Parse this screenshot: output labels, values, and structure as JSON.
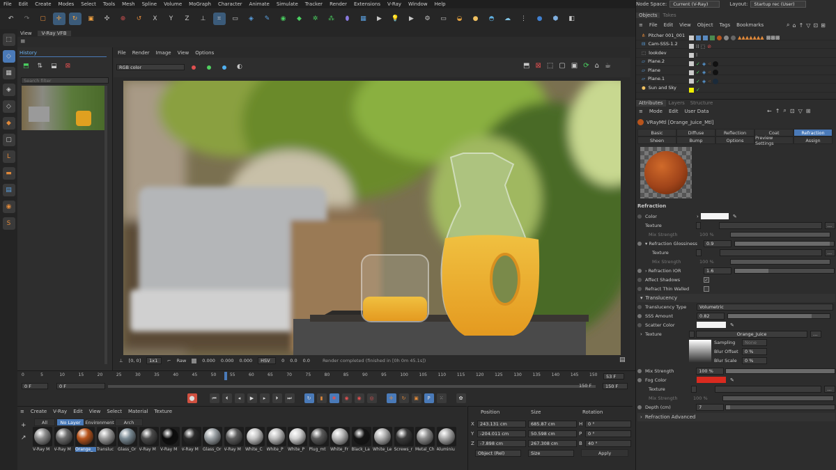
{
  "menubar": {
    "items": [
      "File",
      "Edit",
      "Create",
      "Modes",
      "Select",
      "Tools",
      "Mesh",
      "Spline",
      "Volume",
      "MoGraph",
      "Character",
      "Animate",
      "Simulate",
      "Tracker",
      "Render",
      "Extensions",
      "V-Ray",
      "Window",
      "Help"
    ],
    "node_space_label": "Node Space:",
    "node_space_value": "Current (V-Ray)",
    "layout_label": "Layout:",
    "layout_value": "Startup rec (User)"
  },
  "view_tabs": {
    "view": "View",
    "vfb": "V-Ray VFB"
  },
  "vfb": {
    "history_title": "History",
    "search_placeholder": "Search filter",
    "menu": [
      "File",
      "Render",
      "Image",
      "View",
      "Options"
    ],
    "channel": "RGB color",
    "status": {
      "coords": "[0, 0]",
      "zoom": "1x1",
      "raw_label": "Raw",
      "v1": "0.000",
      "v2": "0.000",
      "v3": "0.000",
      "mode": "HSV",
      "v4": "0",
      "v5": "0.0",
      "v6": "0.0",
      "message": "Render completed (finished in [0h  0m  45.1s])"
    }
  },
  "timeline": {
    "ticks": [
      "0",
      "5",
      "10",
      "15",
      "20",
      "25",
      "30",
      "35",
      "40",
      "45",
      "50",
      "55",
      "60",
      "65",
      "70",
      "75",
      "80",
      "85",
      "90",
      "95",
      "100",
      "105",
      "110",
      "115",
      "120",
      "125",
      "130",
      "135",
      "140",
      "145",
      "150"
    ],
    "current": "53 F",
    "start": "0 F",
    "start2": "0 F",
    "end": "150 F",
    "end2": "150 F"
  },
  "material_manager": {
    "menu": [
      "Create",
      "V-Ray",
      "Edit",
      "View",
      "Select",
      "Material",
      "Texture"
    ],
    "filters": [
      "All",
      "No Layer",
      "Environment",
      "Arch"
    ],
    "active_filter": "No Layer",
    "materials": [
      {
        "name": "V-Ray M",
        "color": "#8a8a8a"
      },
      {
        "name": "V-Ray M",
        "color": "#6c6c6c"
      },
      {
        "name": "Orange_",
        "color": "#b8541c"
      },
      {
        "name": "Transluc",
        "color": "#9a9a9a"
      },
      {
        "name": "Glass_Or",
        "color": "#7a8a94"
      },
      {
        "name": "V-Ray M",
        "color": "#4a4a4a"
      },
      {
        "name": "V-Ray M",
        "color": "#0c0c0c"
      },
      {
        "name": "V-Ray M",
        "color": "#2a2a2a"
      },
      {
        "name": "Glass_Or",
        "color": "#9aa0a4"
      },
      {
        "name": "V-Ray M",
        "color": "#5c5c5c"
      },
      {
        "name": "White_C",
        "color": "#c4c4c4"
      },
      {
        "name": "White_P",
        "color": "#bdbdbd"
      },
      {
        "name": "White_P",
        "color": "#d0d0d0"
      },
      {
        "name": "Plug_mt",
        "color": "#5a5a5a"
      },
      {
        "name": "White_Fr",
        "color": "#b8b8b8"
      },
      {
        "name": "Black_La",
        "color": "#141414"
      },
      {
        "name": "White_Le",
        "color": "#b0b0b0"
      },
      {
        "name": "Screws_r",
        "color": "#3a3a3a"
      },
      {
        "name": "Metal_Ch",
        "color": "#8c8c8c"
      },
      {
        "name": "Aluminiu",
        "color": "#a8a8a8"
      }
    ]
  },
  "coordinates": {
    "headers": [
      "Position",
      "Size",
      "Rotation"
    ],
    "rows": [
      {
        "axis": "X",
        "pos": "243.131 cm",
        "size": "685.87 cm",
        "rlabel": "H",
        "rot": "0 °"
      },
      {
        "axis": "Y",
        "pos": "-204.011 cm",
        "size": "50.598 cm",
        "rlabel": "P",
        "rot": "0 °"
      },
      {
        "axis": "Z",
        "pos": "-7.898 cm",
        "size": "267.308 cm",
        "rlabel": "B",
        "rot": "40 °"
      }
    ],
    "mode": "Object (Rel)",
    "size_mode": "Size",
    "apply": "Apply"
  },
  "objects_panel": {
    "tabs": [
      "Objects",
      "Takes"
    ],
    "menu": [
      "File",
      "Edit",
      "View",
      "Object",
      "Tags",
      "Bookmarks"
    ],
    "objects": [
      "Pitcher 001_001",
      "Cam-SSS-1.2",
      "lookdev",
      "Plane.2",
      "Plane",
      "Plane.1",
      "Sun and Sky"
    ]
  },
  "attributes": {
    "tabs": [
      "Attributes",
      "Layers",
      "Structure"
    ],
    "menu": [
      "Mode",
      "Edit",
      "User Data"
    ],
    "material_name": "VRayMtl [Orange_Juice_Mtl]",
    "mat_tabs_row1": [
      "Basic",
      "Diffuse",
      "Reflection",
      "Coat",
      "Refraction"
    ],
    "mat_tabs_row2": [
      "Sheen",
      "Bump",
      "Options",
      "Preview Settings",
      "Assign"
    ],
    "active_tab": "Refraction",
    "section": "Refraction",
    "color_label": "Color",
    "texture_label": "Texture",
    "mix_strength_label": "Mix Strength",
    "mix_strength_value": "100 %",
    "refl_gloss_label": "Refraction Glossiness",
    "refl_gloss_value": "0.9",
    "texture2_label": "Texture",
    "mix2_label": "Mix Strength",
    "mix2_value": "100 %",
    "ior_label": "Refraction IOR",
    "ior_value": "1.6",
    "affect_shadows": "Affect Shadows",
    "thin_walled": "Refract Thin Walled",
    "translucency_section": "Translucency",
    "trans_type_label": "Translucency Type",
    "trans_type_value": "Volumetric",
    "sss_label": "SSS Amount",
    "sss_value": "0.82",
    "scatter_label": "Scatter Color",
    "tex_label": "Texture",
    "tex_value": "Orange_Juice",
    "sampling_label": "Sampling",
    "sampling_value": "None",
    "blur_offset_label": "Blur Offset",
    "blur_offset_value": "0 %",
    "blur_scale_label": "Blur Scale",
    "blur_scale_value": "0 %",
    "mix3_label": "Mix Strength",
    "mix3_value": "100 %",
    "fog_label": "Fog Color",
    "fog_color": "#d92a1f",
    "texture3_label": "Texture",
    "mix4_label": "Mix Strength",
    "mix4_value": "100 %",
    "depth_label": "Depth (cm)",
    "depth_value": "7",
    "advanced": "Refraction Advanced"
  }
}
